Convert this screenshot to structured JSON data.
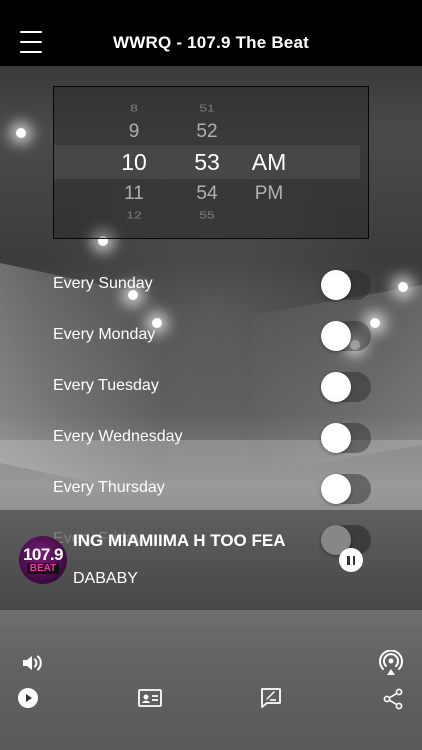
{
  "header": {
    "title": "WWRQ - 107.9 The Beat"
  },
  "time_picker": {
    "hours": [
      "8",
      "9",
      "10",
      "11",
      "12"
    ],
    "minutes": [
      "51",
      "52",
      "53",
      "54",
      "55"
    ],
    "periods": [
      "",
      "",
      "AM",
      "PM",
      ""
    ],
    "selected": {
      "hour": "10",
      "minute": "53",
      "period": "AM"
    }
  },
  "days": [
    {
      "label": "Every Sunday",
      "enabled": false
    },
    {
      "label": "Every Monday",
      "enabled": false
    },
    {
      "label": "Every Tuesday",
      "enabled": false
    },
    {
      "label": "Every Wednesday",
      "enabled": false
    },
    {
      "label": "Every Thursday",
      "enabled": false
    },
    {
      "label": "Every Friday",
      "enabled": false
    }
  ],
  "now_playing": {
    "logo_line1": "107.9",
    "logo_line2": "BEAT",
    "title": "ING MIAMIIMA H TOO FEA",
    "artist": "DABABY"
  },
  "icons": {
    "menu": "menu-icon",
    "volume": "volume-icon",
    "airplay": "airplay-icon",
    "play": "play-icon",
    "contact": "contact-card-icon",
    "request": "request-icon",
    "share": "share-icon",
    "pause": "pause-icon"
  },
  "colors": {
    "header_bg": "#000000",
    "logo_accent": "#ff2fb4"
  }
}
